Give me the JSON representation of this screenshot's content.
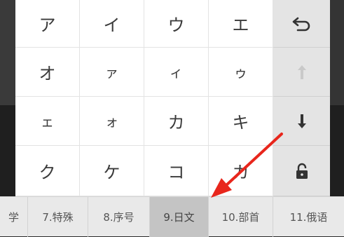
{
  "keyboard": {
    "keys": [
      "ア",
      "イ",
      "ウ",
      "エ",
      "オ",
      "ァ",
      "ィ",
      "ゥ",
      "ェ",
      "ォ",
      "カ",
      "キ",
      "ク",
      "ケ",
      "コ",
      "カ"
    ],
    "function_keys": [
      {
        "name": "undo-icon",
        "state": "active"
      },
      {
        "name": "arrow-up-icon",
        "state": "disabled"
      },
      {
        "name": "arrow-down-icon",
        "state": "active"
      },
      {
        "name": "lock-icon",
        "state": "active"
      }
    ]
  },
  "tabs": [
    {
      "label": "学"
    },
    {
      "label": "7.特殊"
    },
    {
      "label": "8.序号"
    },
    {
      "label": "9.日文",
      "active": true
    },
    {
      "label": "10.部首"
    },
    {
      "label": "11.俄语"
    }
  ],
  "annotation": {
    "arrow_color": "#e8261c"
  }
}
